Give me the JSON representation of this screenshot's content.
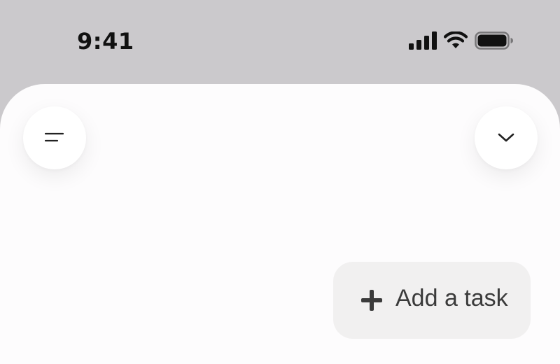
{
  "status_bar": {
    "time": "9:41",
    "icons": [
      "cellular-signal-icon",
      "wifi-icon",
      "battery-icon"
    ]
  },
  "header": {
    "left_button_icon": "menu-lines-icon",
    "right_button_icon": "chevron-down-icon"
  },
  "add_task": {
    "label": "Add a task",
    "icon": "plus-icon"
  },
  "colors": {
    "status_bar_background": "#cbc9cc",
    "sheet_background": "#fdfcfd",
    "add_task_background": "#f1f0f0",
    "text": "#3b3b3b"
  }
}
